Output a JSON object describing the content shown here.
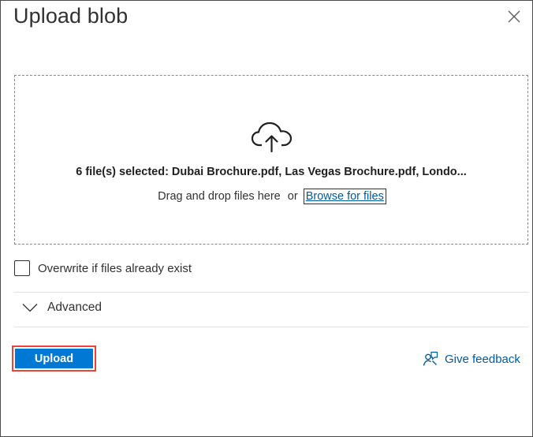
{
  "panel": {
    "title": "Upload blob",
    "close_icon": "close-icon"
  },
  "dropzone": {
    "icon": "cloud-upload-icon",
    "selected_text": "6 file(s) selected: Dubai Brochure.pdf, Las Vegas Brochure.pdf, Londo...",
    "drag_text": "Drag and drop files here",
    "or_text": "or",
    "browse_label": "Browse for files"
  },
  "options": {
    "overwrite_label": "Overwrite if files already exist",
    "overwrite_checked": false,
    "advanced_label": "Advanced",
    "advanced_icon": "chevron-down-icon"
  },
  "footer": {
    "upload_label": "Upload",
    "feedback_label": "Give feedback",
    "feedback_icon": "feedback-icon"
  },
  "colors": {
    "primary": "#0078d4",
    "link": "#005a9e",
    "highlight_border": "#e8443a"
  }
}
